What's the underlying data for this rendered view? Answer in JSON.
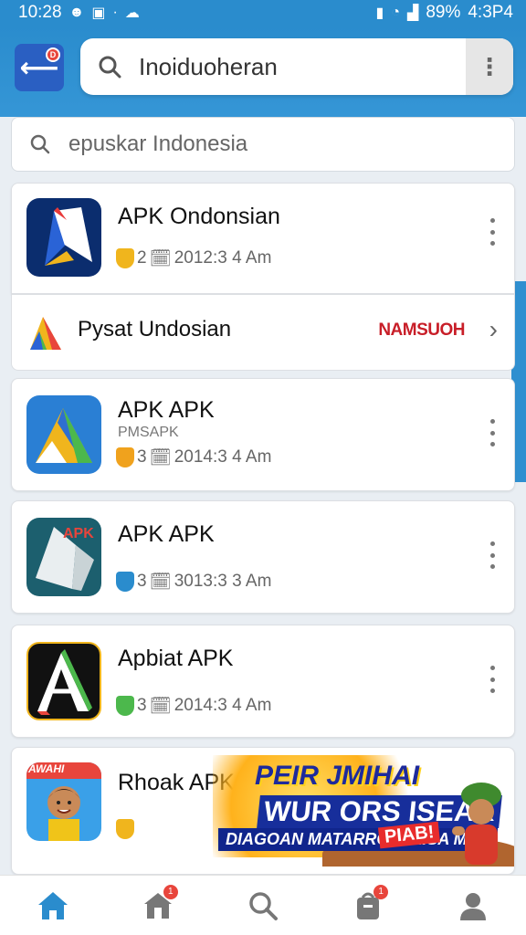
{
  "status_bar": {
    "time": "10:28",
    "battery": "89%",
    "right_time": "4:3P4"
  },
  "header": {
    "back_badge": "D",
    "search_value": "Inoiduoheran"
  },
  "sub_search": {
    "value": "epuskar Indonesia"
  },
  "apps": [
    {
      "title": "APK Ondonsian",
      "subtitle": "",
      "meta_a": "2",
      "meta_b": "2012:3 4 Am",
      "shield_color": "#f0b51d"
    },
    {
      "title": "APK APK",
      "subtitle": "PMSAPK",
      "meta_a": "3",
      "meta_b": "2014:3 4 Am",
      "shield_color": "#f0a21d"
    },
    {
      "title": "APK APK",
      "subtitle": "",
      "meta_a": "3",
      "meta_b": "3013:3 3 Am",
      "shield_color": "#2a8ccd"
    },
    {
      "title": "Apbiat APK",
      "subtitle": "",
      "meta_a": "3",
      "meta_b": "2014:3 4 Am",
      "shield_color": "#4cb84c"
    },
    {
      "title": "Rhoak APK",
      "subtitle": "",
      "meta_a": "",
      "meta_b": "",
      "shield_color": "#f0b51d"
    }
  ],
  "banner": {
    "title": "Pysat Undosian",
    "action": "NAMSUOH"
  },
  "promo": {
    "line1": "PEIR JMIHAI",
    "line2": "WUR ORS ISEAK",
    "line3": "DIAGOAN MATARRGI RAISA MAS",
    "tag": "PIAB!",
    "left_text": "AWAHI"
  },
  "bottom_nav": {
    "home_badge": "1",
    "bag_badge": "1"
  },
  "colors": {
    "brand_blue": "#2a8ccd",
    "accent_red": "#c81e28"
  }
}
